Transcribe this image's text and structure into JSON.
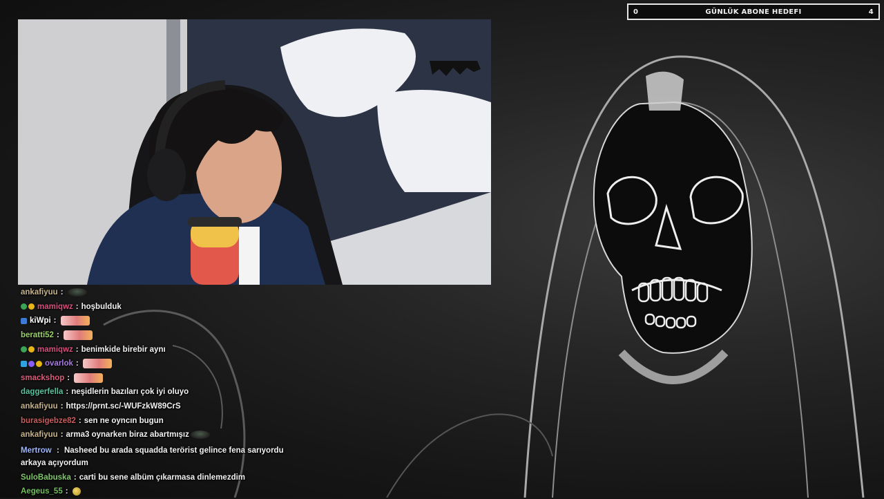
{
  "goal": {
    "label": "GÜNLÜK ABONE HEDEFI",
    "current": "0",
    "target": "4",
    "progress_fraction": 0.0
  },
  "colors": {
    "background": "#151515",
    "goal_border": "#e9e9e9"
  },
  "chat": [
    {
      "user": "ankafiyuu",
      "color": "#c8b48a",
      "badges": [],
      "text": "",
      "emote": "frog-emote"
    },
    {
      "user": "mamiqwz",
      "color": "#d6507e",
      "badges": [
        "#3aa655",
        "#e8b517"
      ],
      "text": "hoşbuldu​k",
      "emote": ""
    },
    {
      "user": "kiWpi",
      "color": "#ffffff",
      "badges": [
        "#3d7ad6"
      ],
      "text": "",
      "emote": "heart-emote"
    },
    {
      "user": "beratti52",
      "color": "#9bd16a",
      "badges": [],
      "text": "",
      "emote": "heart-emote"
    },
    {
      "user": "mamiqwz",
      "color": "#d6507e",
      "badges": [
        "#3aa655",
        "#e8b517"
      ],
      "text": "benimkide birebir aynı",
      "emote": ""
    },
    {
      "user": "ovarlok",
      "color": "#a77be0",
      "badges": [
        "#2fa3e0",
        "#8b5cf6",
        "#e8b517"
      ],
      "text": "",
      "emote": "heart-emote"
    },
    {
      "user": "smackshop",
      "color": "#e05a7a",
      "badges": [],
      "text": "",
      "emote": "heart-emote"
    },
    {
      "user": "daggerfella",
      "color": "#57c2a0",
      "badges": [],
      "text": "neşidlerin bazıları çok iyi oluyo",
      "emote": ""
    },
    {
      "user": "ankafiyuu",
      "color": "#c8b48a",
      "badges": [],
      "text": "https://prnt.sc/-WUFzkW89CrS",
      "emote": ""
    },
    {
      "user": "burasigebze82",
      "color": "#c95c5c",
      "badges": [],
      "text": "sen ne oyncın bugun",
      "emote": ""
    },
    {
      "user": "ankafiyuu",
      "color": "#c8b48a",
      "badges": [],
      "text": "arma3 oynarken biraz abartmışız",
      "emote": "frog-emote"
    },
    {
      "user": "Mertrow",
      "color": "#9db6ff",
      "badges": [],
      "text": "Nasheed bu arada squadda terörist gelince fena sarıyordu arkaya açıyordum",
      "emote": "",
      "wrap": true
    },
    {
      "user": "SuloBabuska",
      "color": "#7fc86b",
      "badges": [],
      "text": "carti bu sene albüm çıkarmasa dinlemezdim",
      "emote": ""
    },
    {
      "user": "Aegeus_55",
      "color": "#6fbf5a",
      "badges": [],
      "text": "",
      "emote": "pepe-emote"
    }
  ]
}
